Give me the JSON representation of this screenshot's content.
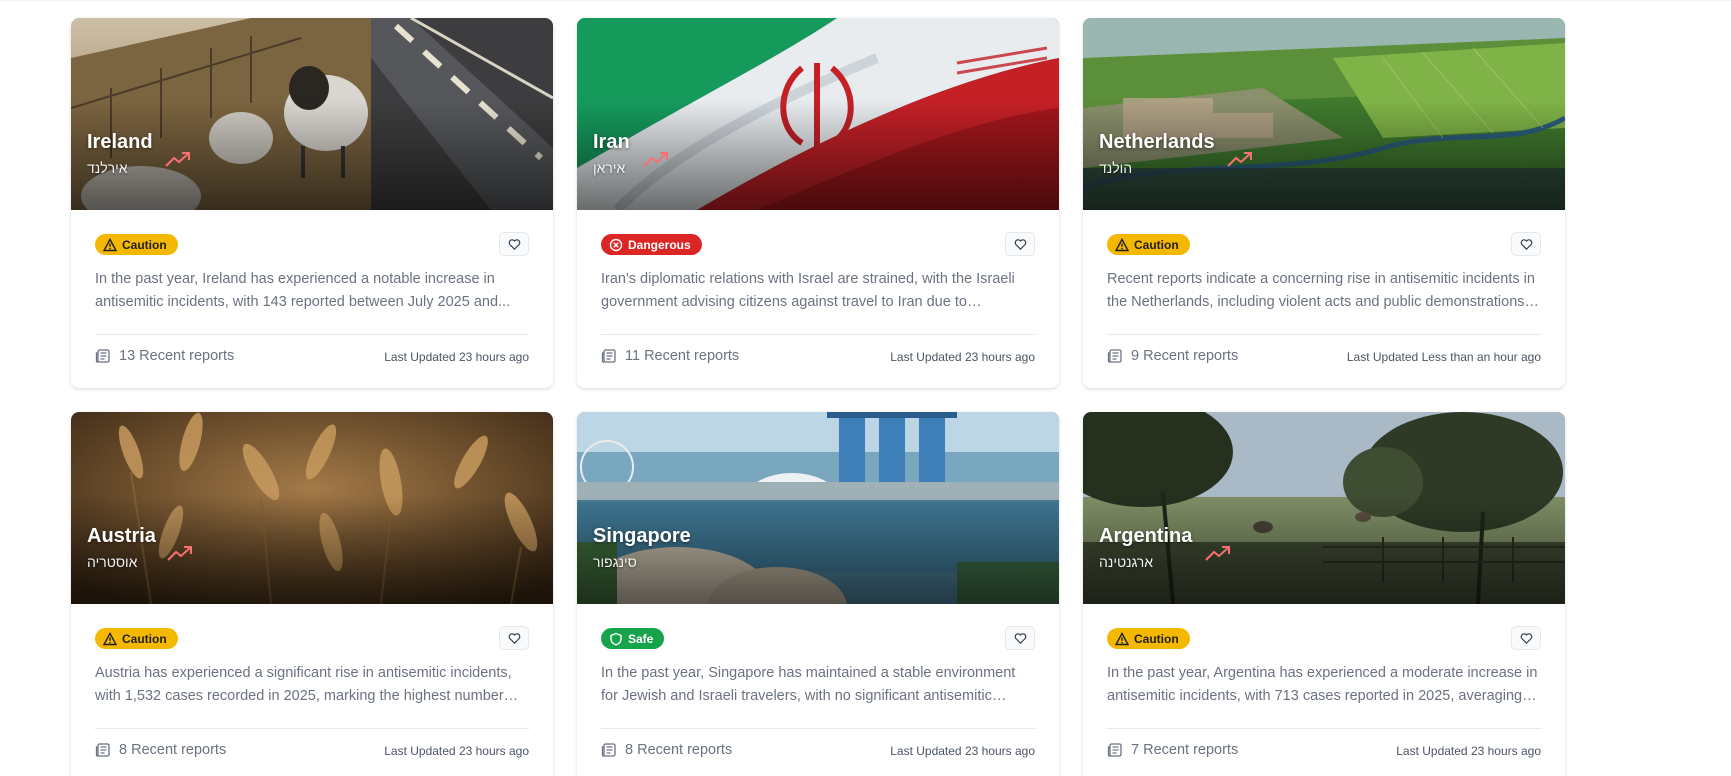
{
  "cards": [
    {
      "country": "Ireland",
      "hebrew": "אירלנד",
      "status": "Caution",
      "status_type": "caution",
      "description": "In the past year, Ireland has experienced a notable increase in antisemitic incidents, with 143 reported between July 2025 and...",
      "reports": "13 Recent reports",
      "updated": "Last Updated 23 hours ago",
      "trend": "trending-up",
      "image": "sheep-on-roadside"
    },
    {
      "country": "Iran",
      "hebrew": "איראן",
      "status": "Dangerous",
      "status_type": "dangerous",
      "description": "Iran's diplomatic relations with Israel are strained, with the Israeli government advising citizens against travel to Iran due to significan...",
      "reports": "11 Recent reports",
      "updated": "Last Updated 23 hours ago",
      "trend": "trending-up",
      "image": "iran-flag"
    },
    {
      "country": "Netherlands",
      "hebrew": "הולנד",
      "status": "Caution",
      "status_type": "caution",
      "description": "Recent reports indicate a concerning rise in antisemitic incidents in the Netherlands, including violent acts and public demonstrations. I...",
      "reports": "9 Recent reports",
      "updated": "Last Updated Less than an hour ago",
      "trend": "trending-up",
      "image": "aerial-farmland"
    },
    {
      "country": "Austria",
      "hebrew": "אוסטריה",
      "status": "Caution",
      "status_type": "caution",
      "description": "Austria has experienced a significant rise in antisemitic incidents, with 1,532 cases recorded in 2025, marking the highest number since...",
      "reports": "8 Recent reports",
      "updated": "Last Updated 23 hours ago",
      "trend": "trending-up",
      "image": "wheat-field"
    },
    {
      "country": "Singapore",
      "hebrew": "סינגפור",
      "status": "Safe",
      "status_type": "safe",
      "description": "In the past year, Singapore has maintained a stable environment for Jewish and Israeli travelers, with no significant antisemitic incidents...",
      "reports": "8 Recent reports",
      "updated": "Last Updated 23 hours ago",
      "trend": "",
      "image": "marina-bay-skyline"
    },
    {
      "country": "Argentina",
      "hebrew": "ארגנטינה",
      "status": "Caution",
      "status_type": "caution",
      "description": "In the past year, Argentina has experienced a moderate increase in antisemitic incidents, with 713 cases reported in 2025, averaging t...",
      "reports": "7 Recent reports",
      "updated": "Last Updated 23 hours ago",
      "trend": "trending-up",
      "image": "trees-pasture-horses"
    }
  ],
  "colors": {
    "caution": "#f5b800",
    "dangerous": "#dc2626",
    "safe": "#16a34a",
    "trend": "#f87171"
  },
  "icons": {
    "caution": "warning-triangle-icon",
    "dangerous": "x-circle-icon",
    "safe": "shield-icon",
    "favorite": "heart-icon",
    "reports": "newspaper-icon",
    "trend": "trending-up-icon"
  }
}
